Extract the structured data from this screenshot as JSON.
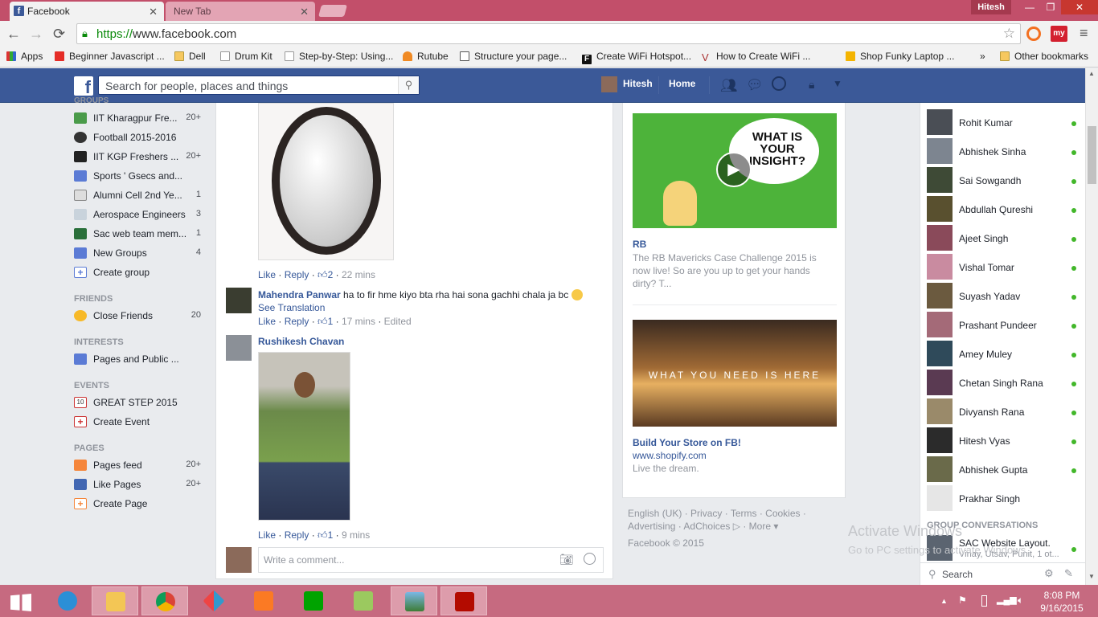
{
  "browser": {
    "tabs": [
      {
        "title": "Facebook",
        "active": true
      },
      {
        "title": "New Tab",
        "active": false
      }
    ],
    "window_user": "Hitesh",
    "url_https": "https://",
    "url_host": "www.facebook.com",
    "bookmarks": [
      {
        "label": "Apps",
        "icon": "apps-grid-icon"
      },
      {
        "label": "Beginner Javascript ...",
        "icon": "youtube-icon"
      },
      {
        "label": "Dell",
        "icon": "folder-icon"
      },
      {
        "label": "Drum Kit",
        "icon": "page-icon"
      },
      {
        "label": "Step-by-Step: Using...",
        "icon": "page-icon"
      },
      {
        "label": "Rutube",
        "icon": "rutube-icon"
      },
      {
        "label": "Structure your page...",
        "icon": "page-icon"
      },
      {
        "label": "Create WiFi Hotspot...",
        "icon": "f-icon"
      },
      {
        "label": "How to Create WiFi ...",
        "icon": "v-icon"
      },
      {
        "label": "Shop Funky Laptop ...",
        "icon": "shop-icon"
      }
    ],
    "bookmarks_more": "»",
    "other_bookmarks": "Other bookmarks"
  },
  "fb_header": {
    "search_placeholder": "Search for people, places and things",
    "user_name": "Hitesh",
    "home_label": "Home"
  },
  "left_nav": {
    "groups_header": "GROUPS",
    "groups": [
      {
        "label": "IIT Kharagpur Fre...",
        "count": "20+"
      },
      {
        "label": "Football 2015-2016",
        "count": ""
      },
      {
        "label": "IIT KGP Freshers ...",
        "count": "20+"
      },
      {
        "label": "Sports ' Gsecs and...",
        "count": ""
      },
      {
        "label": "Alumni Cell 2nd Ye...",
        "count": "1"
      },
      {
        "label": "Aerospace Engineers",
        "count": "3"
      },
      {
        "label": "Sac web team mem...",
        "count": "1"
      },
      {
        "label": "New Groups",
        "count": "4"
      },
      {
        "label": "Create group",
        "count": ""
      }
    ],
    "friends_header": "FRIENDS",
    "friends": [
      {
        "label": "Close Friends",
        "count": "20"
      }
    ],
    "interests_header": "INTERESTS",
    "interests": [
      {
        "label": "Pages and Public ...",
        "count": ""
      }
    ],
    "events_header": "EVENTS",
    "events": [
      {
        "label": "GREAT STEP 2015",
        "count": ""
      },
      {
        "label": "Create Event",
        "count": ""
      }
    ],
    "pages_header": "PAGES",
    "pages": [
      {
        "label": "Pages feed",
        "count": "20+"
      },
      {
        "label": "Like Pages",
        "count": "20+"
      },
      {
        "label": "Create Page",
        "count": ""
      }
    ]
  },
  "feed": {
    "comment1": {
      "like": "Like",
      "reply": "Reply",
      "likes": "2",
      "time": "22 mins"
    },
    "comment2": {
      "author": "Mahendra Panwar",
      "text": "ha to fir hme kiyo bta rha hai sona gachhi chala ja bc",
      "see_translation": "See Translation",
      "like": "Like",
      "reply": "Reply",
      "likes": "1",
      "time": "17 mins",
      "edited": "Edited"
    },
    "comment3": {
      "author": "Rushikesh Chavan",
      "like": "Like",
      "reply": "Reply",
      "likes": "1",
      "time": "9 mins"
    },
    "comment_placeholder": "Write a comment..."
  },
  "ads": [
    {
      "image_text": "WHAT IS YOUR INSIGHT?",
      "title": "RB",
      "body": "The RB Mavericks Case Challenge 2015 is now live! So are you up to get your hands dirty? T..."
    },
    {
      "image_text": "WHAT YOU NEED IS HERE",
      "title": "Build Your Store on FB!",
      "domain": "www.shopify.com",
      "body": "Live the dream."
    }
  ],
  "footer": {
    "line1": [
      "English (UK)",
      "Privacy",
      "Terms",
      "Cookies"
    ],
    "line2": [
      "Advertising",
      "AdChoices",
      "More"
    ],
    "copyright": "Facebook © 2015"
  },
  "chat": {
    "friends": [
      "Rohit Kumar",
      "Abhishek Sinha",
      "Sai Sowgandh",
      "Abdullah Qureshi",
      "Ajeet Singh",
      "Vishal Tomar",
      "Suyash Yadav",
      "Prashant Pundeer",
      "Amey Muley",
      "Chetan Singh Rana",
      "Divyansh Rana",
      "Hitesh Vyas",
      "Abhishek Gupta",
      "Prakhar Singh"
    ],
    "group_header": "GROUP CONVERSATIONS",
    "group_title": "SAC Website Layout.",
    "group_members": "Vinay, Utsav, Punit, 1 ot...",
    "search_label": "Search"
  },
  "watermark": {
    "line1": "Activate Windows",
    "line2": "Go to PC settings to activate Windows."
  },
  "taskbar": {
    "time": "8:08 PM",
    "date": "9/16/2015"
  }
}
